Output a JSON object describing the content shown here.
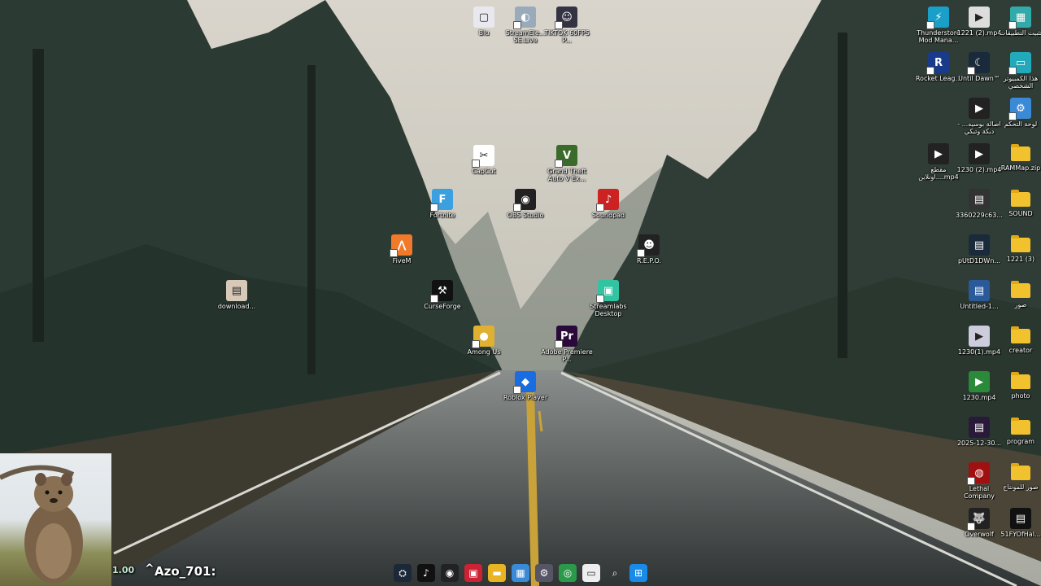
{
  "desktop": {
    "icons": [
      {
        "id": "blu",
        "label": "Blu",
        "type": "file",
        "color": "#e8e8ee",
        "glyph": "▢"
      },
      {
        "id": "streamelements",
        "label": "StreamEle... SE.Live",
        "type": "app",
        "color": "#9ab",
        "glyph": "◐"
      },
      {
        "id": "tiktok-obs",
        "label": "TIKTOK 60FPS P...",
        "type": "app",
        "color": "#334",
        "glyph": "☺"
      },
      {
        "id": "capcut",
        "label": "CapCut",
        "type": "app",
        "color": "#fff",
        "glyph": "✂"
      },
      {
        "id": "gta5",
        "label": "Grand Theft Auto V Ex...",
        "type": "app",
        "color": "#3a6b2a",
        "glyph": "V"
      },
      {
        "id": "fortnite",
        "label": "Fortnite",
        "type": "app",
        "color": "#3aa0e0",
        "glyph": "F"
      },
      {
        "id": "obs",
        "label": "OBS Studio",
        "type": "app",
        "color": "#222",
        "glyph": "◉"
      },
      {
        "id": "soundpad",
        "label": "Soundpad",
        "type": "app",
        "color": "#c22",
        "glyph": "♪"
      },
      {
        "id": "fivem",
        "label": "FiveM",
        "type": "app",
        "color": "#f07a2a",
        "glyph": "⋀"
      },
      {
        "id": "repo",
        "label": "R.E.P.O.",
        "type": "app",
        "color": "#222",
        "glyph": "☻"
      },
      {
        "id": "download",
        "label": "download...",
        "type": "file",
        "color": "#d8c8b8",
        "glyph": "▤"
      },
      {
        "id": "curseforge",
        "label": "CurseForge",
        "type": "app",
        "color": "#111",
        "glyph": "⚒"
      },
      {
        "id": "streamlabs",
        "label": "Streamlabs Desktop",
        "type": "app",
        "color": "#31c3a2",
        "glyph": "▣"
      },
      {
        "id": "among-us",
        "label": "Among Us",
        "type": "app",
        "color": "#e0b030",
        "glyph": "●"
      },
      {
        "id": "premiere",
        "label": "Adobe Premiere P...",
        "type": "app",
        "color": "#2a0a3a",
        "glyph": "Pr"
      },
      {
        "id": "roblox",
        "label": "Roblox Player",
        "type": "app",
        "color": "#1a6de0",
        "glyph": "◆"
      },
      {
        "id": "thunderstore",
        "label": "Thunderstore Mod Mana...",
        "type": "app",
        "color": "#1aa0c8",
        "glyph": "⚡"
      },
      {
        "id": "file-1221-2",
        "label": "1221 (2).mp4",
        "type": "file",
        "color": "#ddd",
        "glyph": "▶"
      },
      {
        "id": "arabic-apps",
        "label": "تثبيت التطبيقات",
        "type": "app",
        "color": "#3aa",
        "glyph": "▦"
      },
      {
        "id": "rocket-league",
        "label": "Rocket Leag...",
        "type": "app",
        "color": "#1a3a8a",
        "glyph": "R"
      },
      {
        "id": "until-dawn",
        "label": "Until Dawn™",
        "type": "app",
        "color": "#1a2a3a",
        "glyph": "☾"
      },
      {
        "id": "this-pc",
        "label": "هذا الكمبيوتر الشخصي",
        "type": "app",
        "color": "#2ab",
        "glyph": "▭"
      },
      {
        "id": "video-clip-1",
        "label": "اصالة بوسيه... - دبكة وتبكي",
        "type": "file",
        "color": "#222",
        "glyph": "▶"
      },
      {
        "id": "control-panel",
        "label": "لوحة التحكم",
        "type": "app",
        "color": "#3a8ad8",
        "glyph": "⚙"
      },
      {
        "id": "clip-cut",
        "label": "مقطع ...اونلاين.mp4",
        "type": "file",
        "color": "#222",
        "glyph": "▶"
      },
      {
        "id": "file-1230-2",
        "label": "1230 (2).mp4",
        "type": "file",
        "color": "#222",
        "glyph": "▶"
      },
      {
        "id": "rammap",
        "label": "RAMMap.zip",
        "type": "folder",
        "color": "#f2c22e",
        "glyph": ""
      },
      {
        "id": "file-3360",
        "label": "3360229c63...",
        "type": "file",
        "color": "#333",
        "glyph": "▤"
      },
      {
        "id": "sound",
        "label": "SOUND",
        "type": "folder",
        "color": "#f2c22e",
        "glyph": ""
      },
      {
        "id": "pupid",
        "label": "pUtD1DWn...",
        "type": "file",
        "color": "#1a2a3a",
        "glyph": "▤"
      },
      {
        "id": "folder-1221-3",
        "label": "1221 (3)",
        "type": "folder",
        "color": "#f2c22e",
        "glyph": ""
      },
      {
        "id": "untitled",
        "label": "Untitled-1...",
        "type": "file",
        "color": "#2a5a9a",
        "glyph": "▤"
      },
      {
        "id": "pictures-ar",
        "label": "صور",
        "type": "folder",
        "color": "#f2c22e",
        "glyph": ""
      },
      {
        "id": "file-1230-1",
        "label": "1230(1).mp4",
        "type": "file",
        "color": "#ccd",
        "glyph": "▶"
      },
      {
        "id": "creator",
        "label": "creator",
        "type": "folder",
        "color": "#f2c22e",
        "glyph": ""
      },
      {
        "id": "file-1230",
        "label": "1230.mp4",
        "type": "file",
        "color": "#2a8a3a",
        "glyph": "▶"
      },
      {
        "id": "photo",
        "label": "photo",
        "type": "folder",
        "color": "#f2c22e",
        "glyph": ""
      },
      {
        "id": "file-2025",
        "label": "2025-12-30...",
        "type": "file",
        "color": "#2a1a3a",
        "glyph": "▤"
      },
      {
        "id": "program",
        "label": "program",
        "type": "folder",
        "color": "#f2c22e",
        "glyph": ""
      },
      {
        "id": "lethal",
        "label": "Lethal Company",
        "type": "app",
        "color": "#a01010",
        "glyph": "◍"
      },
      {
        "id": "montage-pics",
        "label": "صور للمونتاج",
        "type": "folder",
        "color": "#f2c22e",
        "glyph": ""
      },
      {
        "id": "overwolf",
        "label": "Overwolf",
        "type": "app",
        "color": "#222",
        "glyph": "🐺"
      },
      {
        "id": "file-51fy",
        "label": "51FYOfHal...",
        "type": "file",
        "color": "#111",
        "glyph": "▤"
      }
    ]
  },
  "overlay": {
    "counter": "1.00",
    "username": "Azo_701:"
  },
  "taskbar": {
    "items": [
      {
        "id": "steam",
        "icon": "steam-icon",
        "glyph": "⛭",
        "color": "#1b2838"
      },
      {
        "id": "tiktok",
        "icon": "tiktok-icon",
        "glyph": "♪",
        "color": "#111"
      },
      {
        "id": "obs",
        "icon": "obs-icon",
        "glyph": "◉",
        "color": "#222"
      },
      {
        "id": "video-editor",
        "icon": "video-editor-icon",
        "glyph": "▣",
        "color": "#c23"
      },
      {
        "id": "explorer",
        "icon": "folder-icon",
        "glyph": "▬",
        "color": "#e8b423"
      },
      {
        "id": "store",
        "icon": "store-icon",
        "glyph": "▦",
        "color": "#3a8ad8"
      },
      {
        "id": "settings",
        "icon": "gear-icon",
        "glyph": "⚙",
        "color": "#556"
      },
      {
        "id": "chrome",
        "icon": "chrome-icon",
        "glyph": "◎",
        "color": "#2a9a4a"
      },
      {
        "id": "task-view",
        "icon": "task-view-icon",
        "glyph": "▭",
        "color": "#eee"
      },
      {
        "id": "search",
        "icon": "search-icon",
        "glyph": "⌕",
        "color": "transparent"
      },
      {
        "id": "start",
        "icon": "windows-icon",
        "glyph": "⊞",
        "color": "#1a8ae8"
      }
    ]
  }
}
